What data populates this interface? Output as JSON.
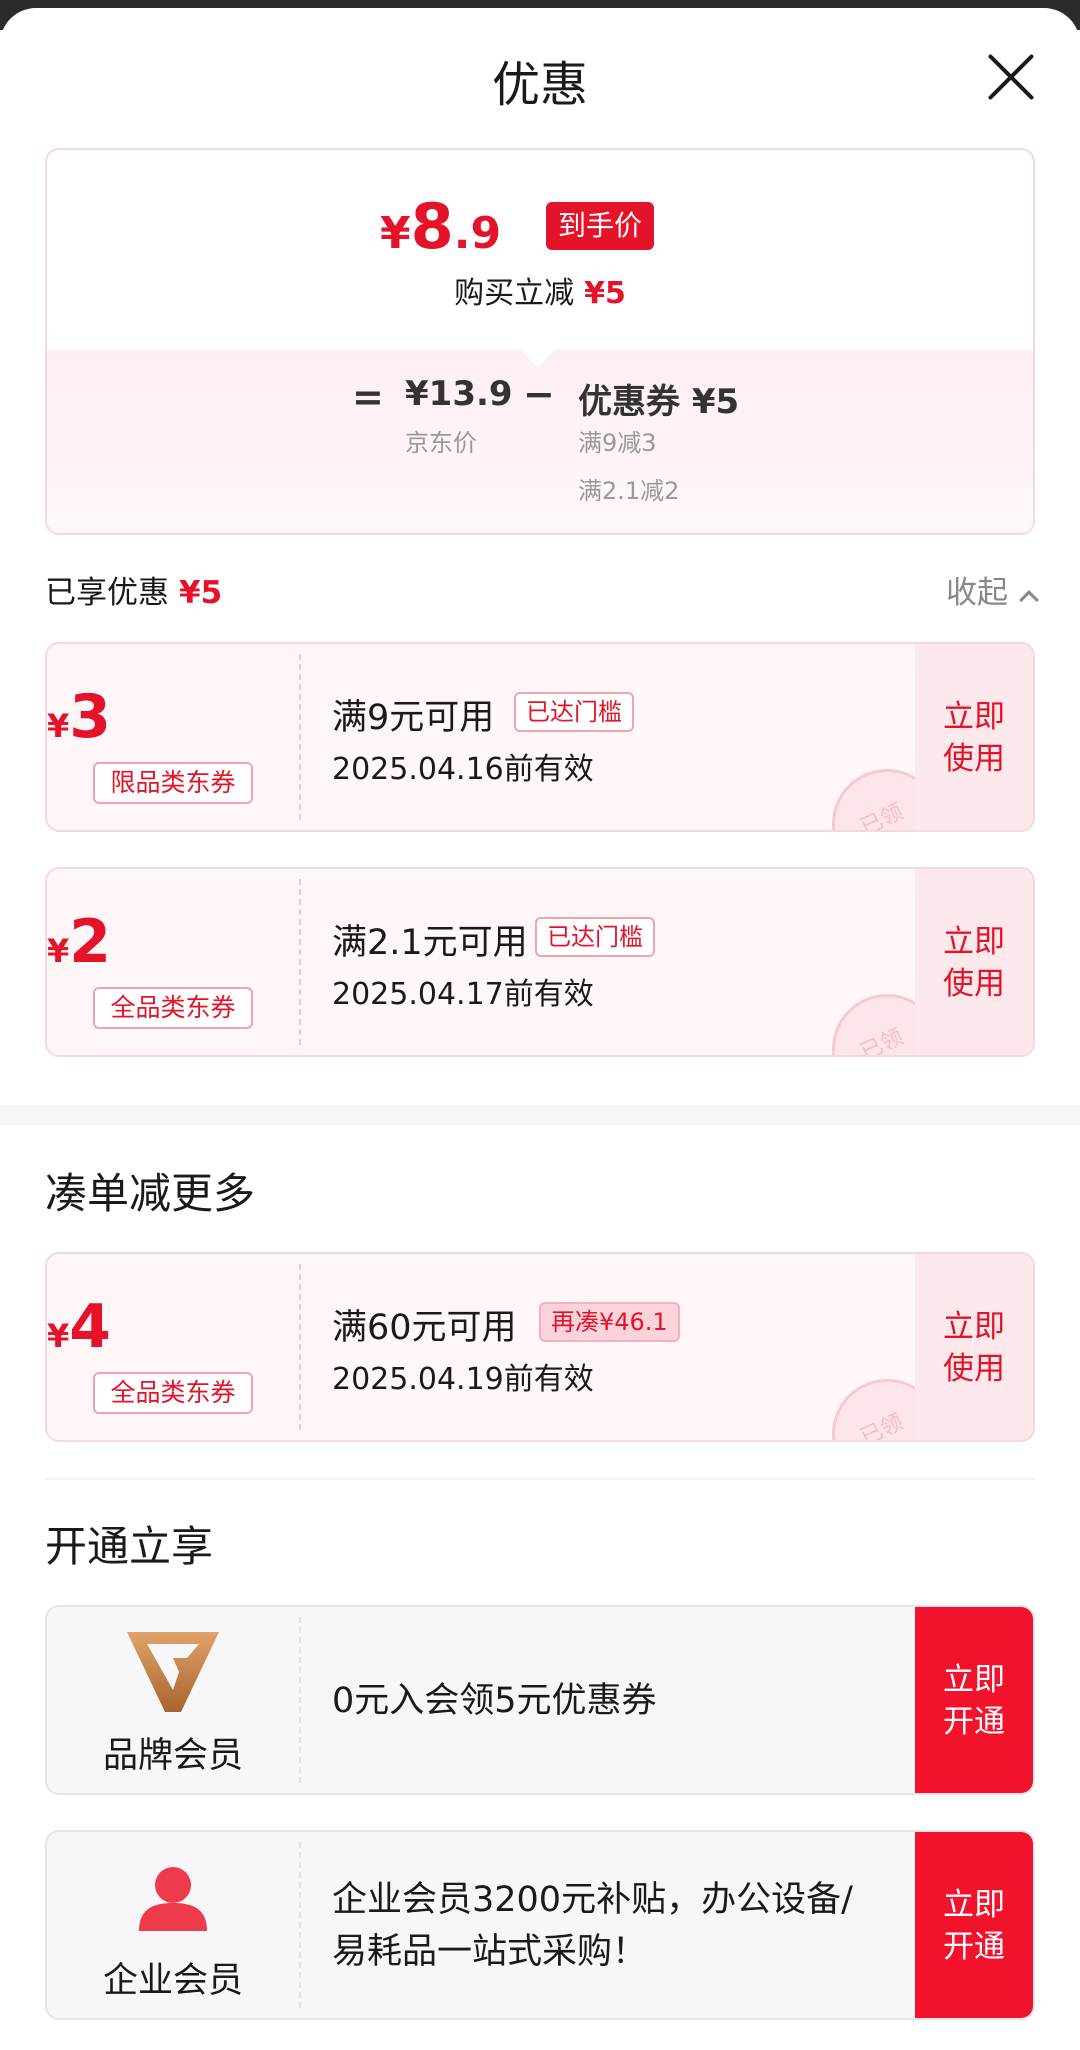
{
  "header": {
    "title": "优惠"
  },
  "summary": {
    "currency": "¥",
    "final_price_int": "8",
    "final_price_dec": ".9",
    "final_tag": "到手价",
    "reduce_text": "购买立减",
    "reduce_amount": "¥5",
    "eq": "=",
    "minus": "−",
    "jd_price": "¥13.9",
    "jd_label": "京东价",
    "coupon_label": "优惠券 ¥5",
    "coupon_sub1": "满9减3",
    "coupon_sub2": "满2.1减2"
  },
  "enjoyed": {
    "label": "已享优惠",
    "amount": "¥5",
    "collapse": "收起"
  },
  "coupons": [
    {
      "currency": "¥",
      "amount": "3",
      "type": "限品类东券",
      "condition": "满9元可用",
      "badge": "已达门槛",
      "date": "2025.04.16前有效",
      "stamp": "已领",
      "action_line1": "立即",
      "action_line2": "使用"
    },
    {
      "currency": "¥",
      "amount": "2",
      "type": "全品类东券",
      "condition": "满2.1元可用",
      "badge": "已达门槛",
      "date": "2025.04.17前有效",
      "stamp": "已领",
      "action_line1": "立即",
      "action_line2": "使用"
    }
  ],
  "more_section": {
    "title": "凑单减更多",
    "coupon": {
      "currency": "¥",
      "amount": "4",
      "type": "全品类东券",
      "condition": "满60元可用",
      "badge": "再凑¥46.1",
      "date": "2025.04.19前有效",
      "stamp": "已领",
      "action_line1": "立即",
      "action_line2": "使用"
    }
  },
  "open_section": {
    "title": "开通立享",
    "members": [
      {
        "icon": "brand-v-logo",
        "label": "品牌会员",
        "text": "0元入会领5元优惠券",
        "action_line1": "立即",
        "action_line2": "开通"
      },
      {
        "icon": "person-icon",
        "label": "企业会员",
        "text_line1": "企业会员3200元补贴，办公设备/",
        "text_line2": "易耗品一站式采购！",
        "action_line1": "立即",
        "action_line2": "开通"
      }
    ]
  },
  "colors": {
    "accent": "#e5132a",
    "button_red": "#f2122c",
    "coupon_bg": "#fff6f7"
  }
}
